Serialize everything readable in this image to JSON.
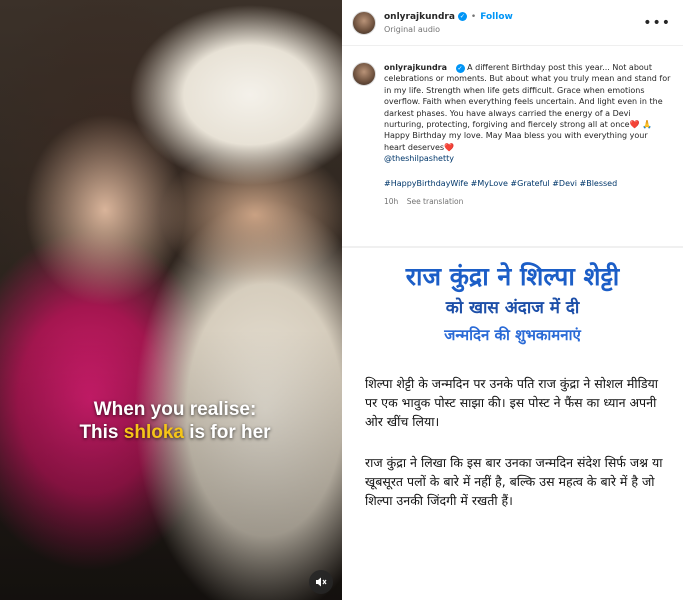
{
  "video": {
    "overlay_line1": "When you realise:",
    "overlay_line2_pre": "This ",
    "overlay_line2_highlight": "shloka",
    "overlay_line2_post": " is for her",
    "mute_icon": "speaker-muted-icon"
  },
  "header": {
    "username": "onlyrajkundra",
    "separator": "•",
    "follow_label": "Follow",
    "audio_label": "Original audio",
    "more_icon": "•••"
  },
  "caption": {
    "username": "onlyrajkundra",
    "text": "A different Birthday post this year... Not about celebrations or moments. But about what you truly mean and stand for in my life. Strength when life gets difficult. Grace when emotions overflow. Faith when everything feels uncertain. And light even in the darkest phases. You have always carried the energy of a Devi nurturing, protecting, forgiving and fiercely strong all at once❤️ 🙏",
    "wish": "Happy Birthday my love. May Maa bless you with everything your heart deserves❤️",
    "mention": "@theshilpashetty",
    "hashtags": "#HappyBirthdayWife #MyLove #Grateful #Devi #Blessed",
    "time": "10h",
    "see_translation": "See translation"
  },
  "news": {
    "title": "राज कुंद्रा ने शिल्पा शेट्टी",
    "subtitle1": "को खास अंदाज में दी",
    "subtitle2": "जन्मदिन की शुभकामनाएं",
    "para1": "शिल्पा शेट्टी के जन्मदिन पर उनके पति राज कुंद्रा ने सोशल मीडिया पर एक भावुक पोस्ट साझा की। इस पोस्ट ने फैंस का ध्यान अपनी ओर खींच लिया।",
    "para2": "राज कुंद्रा ने लिखा कि इस बार उनका जन्मदिन संदेश सिर्फ जश्न या खूबसूरत पलों के बारे में नहीं है, बल्कि उस महत्व के बारे में है जो शिल्पा उनकी जिंदगी में रखती हैं।"
  },
  "colors": {
    "link": "#00376b",
    "follow": "#0095f6",
    "title_blue": "#1c5ec7",
    "highlight_yellow": "#f5c518"
  }
}
